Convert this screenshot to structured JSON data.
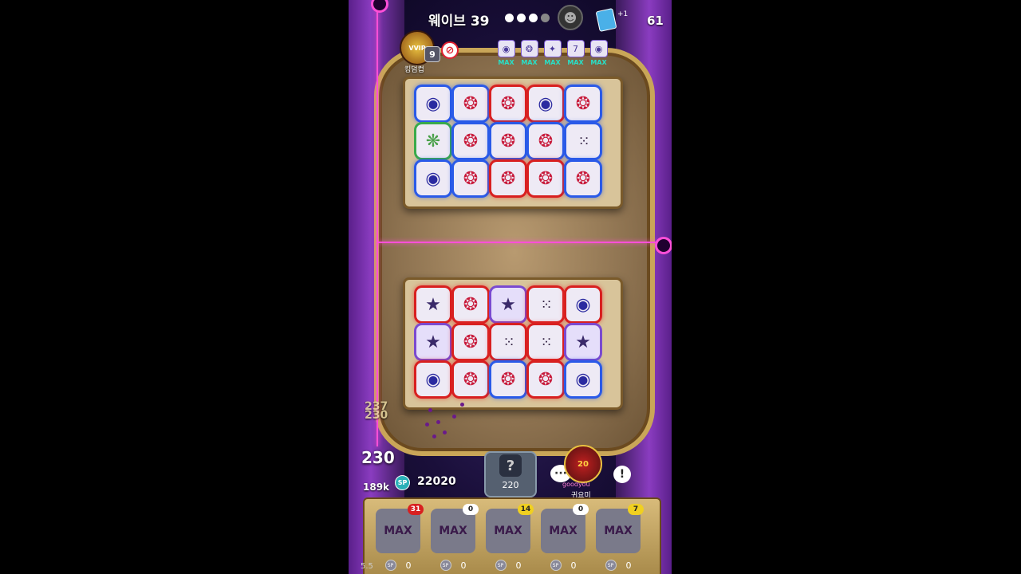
{
  "hud": {
    "wave_label": "웨이브 39",
    "wave_dots": [
      true,
      true,
      true,
      false
    ],
    "card_plus": "+1",
    "card_count": "61",
    "vvip_label": "VVIP",
    "player_level": "9",
    "player_name": "킹덤컵"
  },
  "upgrades": [
    {
      "icon": "◉",
      "label": "MAX"
    },
    {
      "icon": "❂",
      "label": "MAX"
    },
    {
      "icon": "✦",
      "label": "MAX"
    },
    {
      "icon": "7",
      "label": "MAX"
    },
    {
      "icon": "◉",
      "label": "MAX"
    }
  ],
  "top_board": [
    [
      "vortex",
      "blue"
    ],
    [
      "swirl",
      "blue"
    ],
    [
      "swirl",
      "red"
    ],
    [
      "vortex",
      "red"
    ],
    [
      "swirl",
      "blue"
    ],
    [
      "cog",
      "green"
    ],
    [
      "swirl",
      "blue"
    ],
    [
      "swirl",
      "blue"
    ],
    [
      "swirl",
      "blue"
    ],
    [
      "dots",
      "blue"
    ],
    [
      "vortex",
      "blue"
    ],
    [
      "swirl",
      "blue"
    ],
    [
      "swirl",
      "red"
    ],
    [
      "swirl",
      "red"
    ],
    [
      "swirl",
      "blue"
    ]
  ],
  "bottom_board": [
    [
      "star",
      "red"
    ],
    [
      "swirl",
      "red"
    ],
    [
      "star",
      "purple"
    ],
    [
      "dots",
      "red"
    ],
    [
      "vortex",
      "red"
    ],
    [
      "star",
      "purple"
    ],
    [
      "swirl",
      "red"
    ],
    [
      "dots",
      "red"
    ],
    [
      "dots",
      "red"
    ],
    [
      "star",
      "purple"
    ],
    [
      "vortex",
      "red"
    ],
    [
      "swirl",
      "red"
    ],
    [
      "swirl",
      "blue"
    ],
    [
      "swirl",
      "red"
    ],
    [
      "vortex",
      "blue"
    ]
  ],
  "bottom": {
    "hp_ghost_1": "237",
    "hp_ghost_2": "230",
    "hp": "230",
    "money": "189k",
    "sp_icon": "SP",
    "sp_amount": "22020",
    "summon_icon": "?",
    "summon_cost": "220",
    "emote": "···",
    "opponent_level": "20",
    "opponent_tag": "goodyou",
    "opponent_name": "귀요미",
    "alert": "!",
    "version": "5.5"
  },
  "slots": [
    {
      "label": "MAX",
      "count": "31",
      "badge": "#d82020",
      "cost": "0"
    },
    {
      "label": "MAX",
      "count": "0",
      "badge": "#ffffff",
      "cost": "0"
    },
    {
      "label": "MAX",
      "count": "14",
      "badge": "#f0d020",
      "cost": "0"
    },
    {
      "label": "MAX",
      "count": "0",
      "badge": "#ffffff",
      "cost": "0"
    },
    {
      "label": "MAX",
      "count": "7",
      "badge": "#f0d020",
      "cost": "0"
    }
  ]
}
